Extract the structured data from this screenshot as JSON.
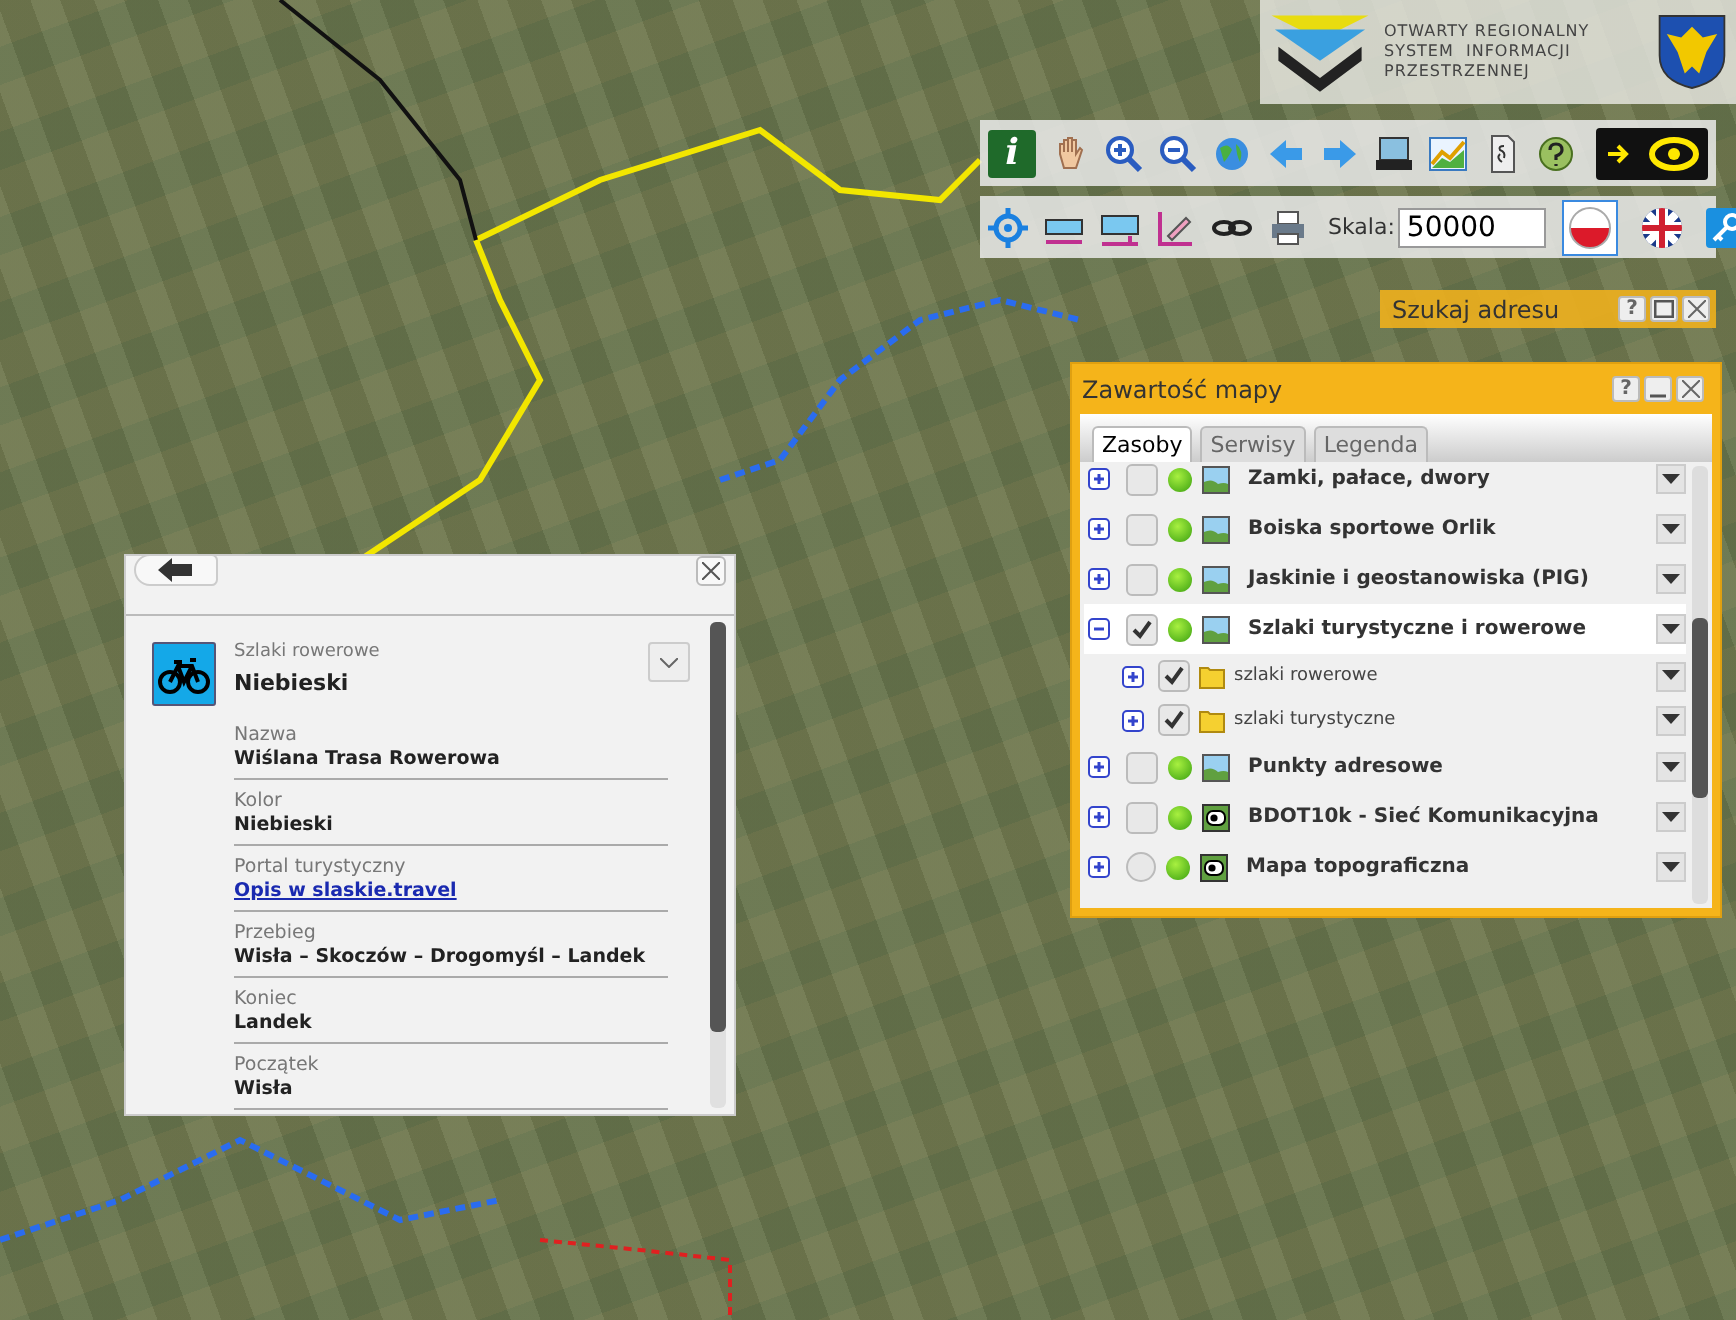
{
  "logo": {
    "lines": [
      "OTWARTY REGIONALNY",
      "SYSTEM  INFORMACJI",
      "PRZESTRZENNEJ"
    ]
  },
  "toolbar_top": {
    "info_label": "i",
    "eye_toggle_on": true
  },
  "toolbar_bottom": {
    "scale_label": "Skala:",
    "scale_value": "50000",
    "languages": [
      {
        "selected": true
      },
      {
        "selected": false
      }
    ]
  },
  "address_panel": {
    "title": "Szukaj adresu",
    "help": "?"
  },
  "map_contents": {
    "title": "Zawartość mapy",
    "help": "?",
    "tabs": [
      {
        "label": "Zasoby",
        "selected": true
      },
      {
        "label": "Serwisy",
        "selected": false
      },
      {
        "label": "Legenda",
        "selected": false
      }
    ],
    "layers": [
      {
        "name": "Zamki, pałace, dwory",
        "kind": "image",
        "checked": false,
        "expanded": false,
        "selected": false
      },
      {
        "name": "Boiska sportowe Orlik",
        "kind": "image",
        "checked": false,
        "expanded": false,
        "selected": false
      },
      {
        "name": "Jaskinie i geostanowiska (PIG)",
        "kind": "image",
        "checked": false,
        "expanded": false,
        "selected": false
      },
      {
        "name": "Szlaki turystyczne i rowerowe",
        "kind": "image",
        "checked": true,
        "expanded": true,
        "selected": true,
        "children": [
          {
            "name": "szlaki rowerowe",
            "checked": true,
            "expanded": false
          },
          {
            "name": "szlaki turystyczne",
            "checked": true,
            "expanded": false
          }
        ]
      },
      {
        "name": "Punkty adresowe",
        "kind": "image",
        "checked": false,
        "expanded": false,
        "selected": false
      },
      {
        "name": "BDOT10k - Sieć Komunikacyjna",
        "kind": "vector",
        "checked": false,
        "expanded": false,
        "selected": false
      },
      {
        "name": "Mapa topograficzna",
        "kind": "basemap",
        "checked": false,
        "expanded": false,
        "selected": false
      }
    ]
  },
  "info_popup": {
    "category": "Szlaki rowerowe",
    "title": "Niebieski",
    "fields": [
      {
        "label": "Nazwa",
        "value": "Wiślana Trasa Rowerowa",
        "kind": "text"
      },
      {
        "label": "Kolor",
        "value": "Niebieski",
        "kind": "text"
      },
      {
        "label": "Portal turystyczny",
        "value": "Opis w slaskie.travel",
        "kind": "link"
      },
      {
        "label": "Przebieg",
        "value": "Wisła – Skoczów – Drogomyśl – Landek",
        "kind": "text"
      },
      {
        "label": "Koniec",
        "value": "Landek",
        "kind": "text"
      },
      {
        "label": "Początek",
        "value": "Wisła",
        "kind": "text"
      }
    ]
  }
}
